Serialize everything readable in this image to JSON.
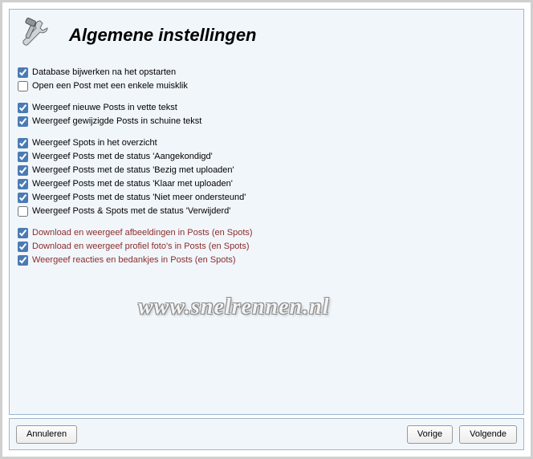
{
  "header": {
    "title": "Algemene instellingen"
  },
  "groups": [
    {
      "items": [
        {
          "label": "Database bijwerken na het opstarten",
          "checked": true,
          "red": false
        },
        {
          "label": "Open een Post met een enkele muisklik",
          "checked": false,
          "red": false
        }
      ]
    },
    {
      "items": [
        {
          "label": "Weergeef nieuwe Posts in vette tekst",
          "checked": true,
          "red": false
        },
        {
          "label": "Weergeef gewijzigde Posts in schuine tekst",
          "checked": true,
          "red": false
        }
      ]
    },
    {
      "items": [
        {
          "label": "Weergeef Spots in het overzicht",
          "checked": true,
          "red": false
        },
        {
          "label": "Weergeef Posts met de status 'Aangekondigd'",
          "checked": true,
          "red": false
        },
        {
          "label": "Weergeef Posts met de status 'Bezig met uploaden'",
          "checked": true,
          "red": false
        },
        {
          "label": "Weergeef Posts met de status 'Klaar met uploaden'",
          "checked": true,
          "red": false
        },
        {
          "label": "Weergeef Posts met de status 'Niet meer ondersteund'",
          "checked": true,
          "red": false
        },
        {
          "label": "Weergeef Posts & Spots met de status 'Verwijderd'",
          "checked": false,
          "red": false
        }
      ]
    },
    {
      "items": [
        {
          "label": "Download en weergeef afbeeldingen in Posts (en Spots)",
          "checked": true,
          "red": true
        },
        {
          "label": "Download en weergeef profiel foto's in Posts (en Spots)",
          "checked": true,
          "red": true
        },
        {
          "label": "Weergeef reacties en bedankjes in Posts (en Spots)",
          "checked": true,
          "red": true
        }
      ]
    }
  ],
  "buttons": {
    "cancel": "Annuleren",
    "previous": "Vorige",
    "next": "Volgende"
  },
  "watermark": "www.snelrennen.nl"
}
